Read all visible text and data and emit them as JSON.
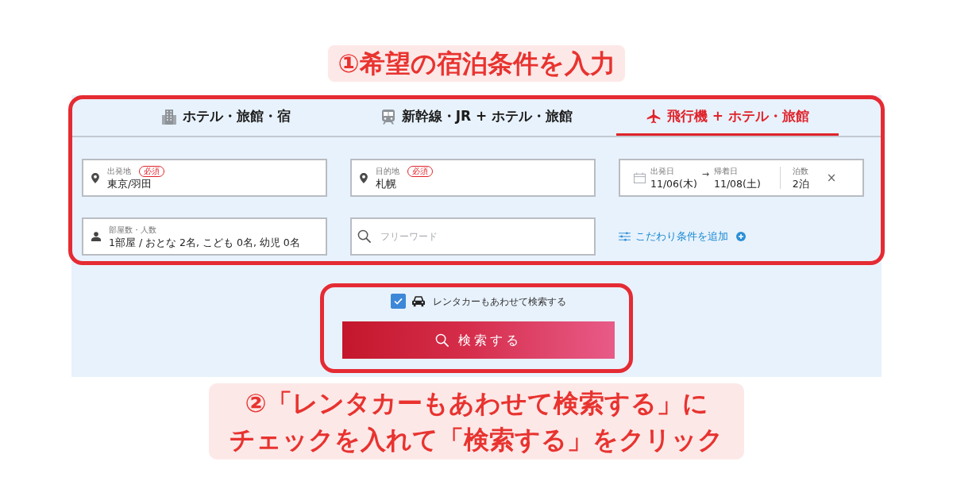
{
  "step_1_note": "①希望の宿泊条件を入力",
  "tabs": [
    {
      "label": "ホテル・旅館・宿",
      "kind": "hotel",
      "selected": false
    },
    {
      "label": "新幹線・JR + ホテル・旅館",
      "kind": "train",
      "selected": false
    },
    {
      "label": "飛行機 + ホテル・旅館",
      "kind": "plane",
      "selected": true
    }
  ],
  "fields": [
    {
      "kind": "place",
      "label": "出発地",
      "badge": "必須",
      "value": "東京/羽田"
    },
    {
      "kind": "place",
      "label": "目的地",
      "badge": "必須",
      "value": "札幌"
    },
    {
      "kind": "dates",
      "departure_label": "出発日",
      "departure": "11/06(木)",
      "arrow": "→",
      "return_label": "帰着日",
      "return": "11/08(土)",
      "nights_label": "泊数",
      "nights": "2泊",
      "clear": "×"
    },
    {
      "kind": "guests",
      "label": "部屋数・人数",
      "value": "1部屋 / おとな 2名, こども 0名, 幼児 0名"
    },
    {
      "kind": "keyword",
      "placeholder": "フリーワード"
    },
    {
      "kind": "add_conditions",
      "label": "こだわり条件を追加"
    }
  ],
  "rental_car": {
    "label": "レンタカーもあわせて検索する",
    "checked": true
  },
  "search_button": {
    "label": "検索する"
  },
  "step_2_note": "②「レンタカーもあわせて検索する」にチェックを入れて「検索する」をクリック"
}
